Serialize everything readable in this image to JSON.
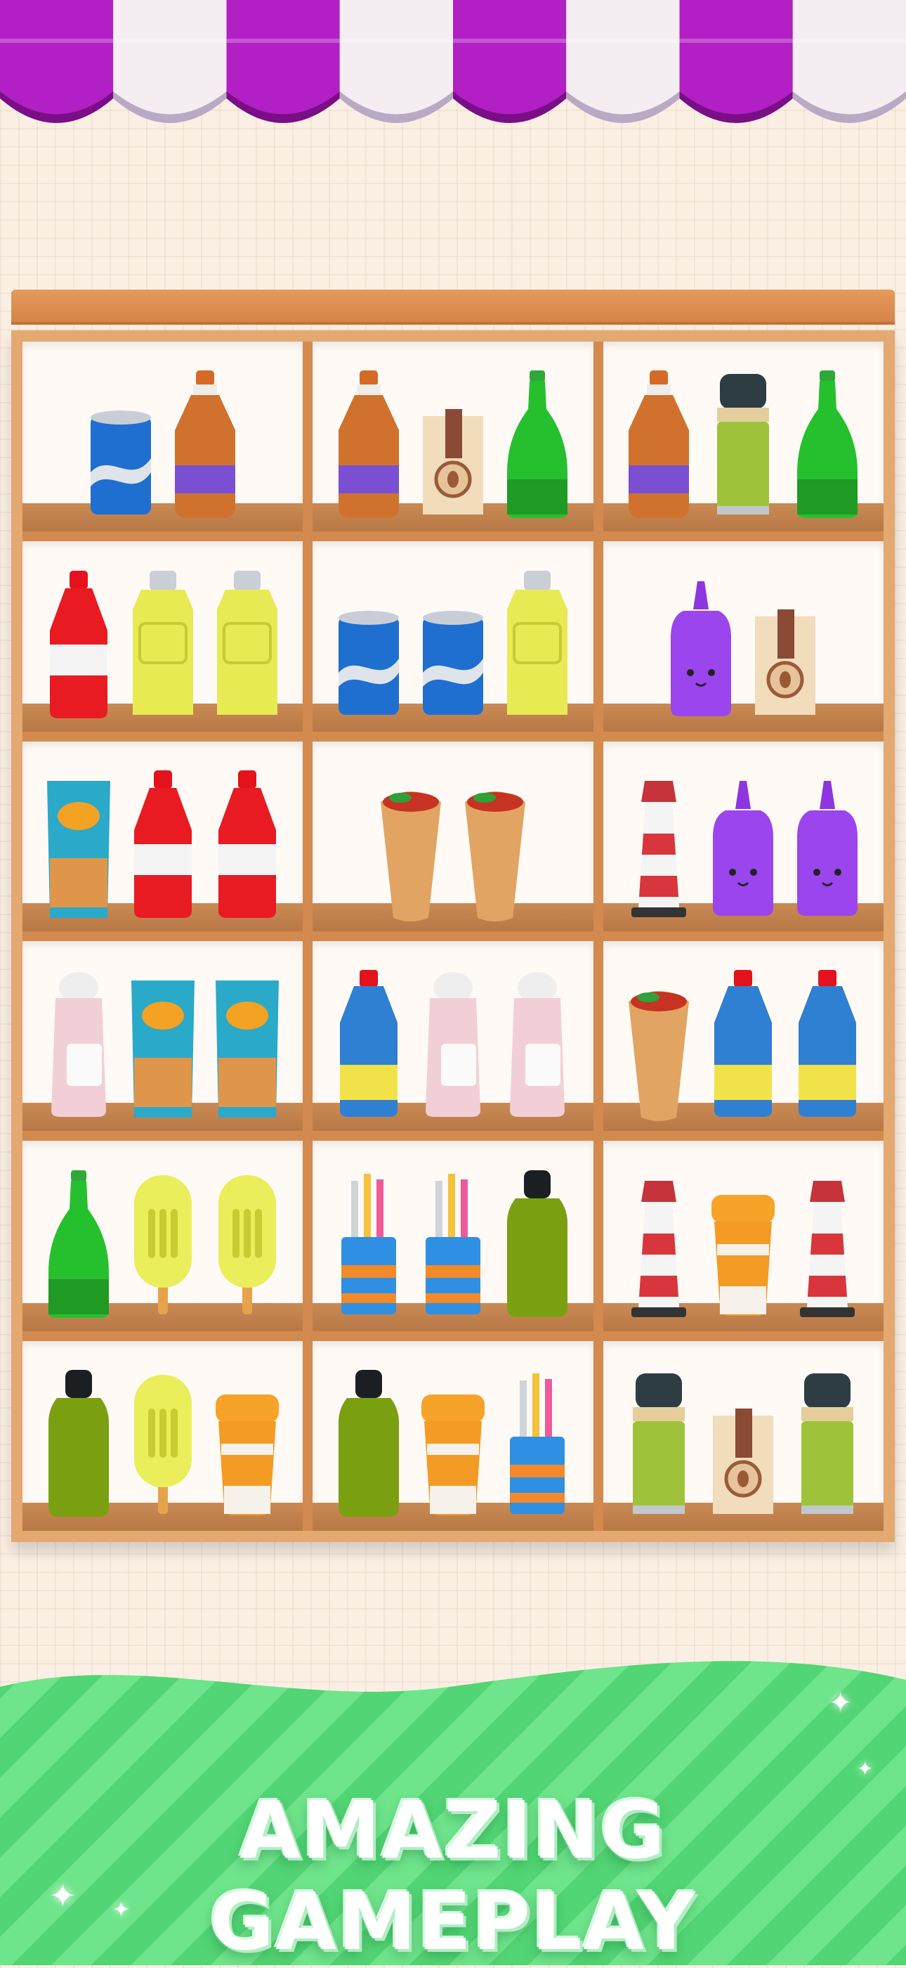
{
  "banner": {
    "title": "AMAZING GAMEPLAY"
  },
  "colors": {
    "awning_purple": "#b21fc4",
    "awning_white": "#f4eef2",
    "shelf_wood": "#e4a871",
    "banner_green": "#5fe07e"
  },
  "shelves": [
    [
      [
        "soda-can",
        "orange-bottle"
      ],
      [
        "orange-bottle",
        "coffee-bag",
        "green-bottle"
      ],
      [
        "orange-bottle",
        "thermos",
        "green-bottle"
      ]
    ],
    [
      [
        "red-bottle",
        "yellow-jug",
        "yellow-jug"
      ],
      [
        "soda-can",
        "soda-can",
        "yellow-jug"
      ],
      [
        "purple-squeeze-bottle",
        "coffee-bag"
      ]
    ],
    [
      [
        "chips-bag",
        "red-bottle",
        "red-bottle"
      ],
      [
        "burrito",
        "burrito"
      ],
      [
        "lighthouse",
        "purple-squeeze-bottle",
        "purple-squeeze-bottle"
      ]
    ],
    [
      [
        "pink-bottle",
        "chips-bag",
        "chips-bag"
      ],
      [
        "cleaner-bottle",
        "pink-bottle",
        "pink-bottle"
      ],
      [
        "burrito",
        "cleaner-bottle",
        "cleaner-bottle"
      ]
    ],
    [
      [
        "green-bottle",
        "popsicle",
        "popsicle"
      ],
      [
        "pencil-cup",
        "pencil-cup",
        "sport-bottle"
      ],
      [
        "lighthouse",
        "coffee-cup",
        "lighthouse"
      ]
    ],
    [
      [
        "sport-bottle",
        "popsicle",
        "coffee-cup"
      ],
      [
        "sport-bottle",
        "coffee-cup",
        "pencil-cup"
      ],
      [
        "thermos",
        "coffee-bag",
        "thermos"
      ]
    ]
  ]
}
